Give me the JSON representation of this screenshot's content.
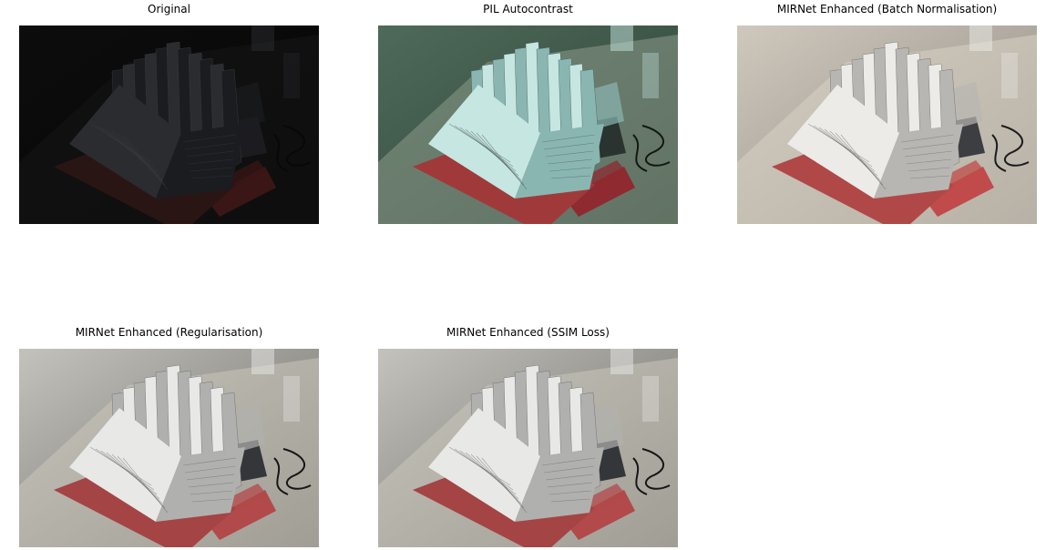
{
  "panels": [
    {
      "title": "Original",
      "variant": "dark"
    },
    {
      "title": "PIL Autocontrast",
      "variant": "teal"
    },
    {
      "title": "MIRNet Enhanced (Batch Normalisation)",
      "variant": "warm"
    },
    {
      "title": "MIRNet Enhanced (Regularisation)",
      "variant": "neutral"
    },
    {
      "title": "MIRNet Enhanced (SSIM Loss)",
      "variant": "neutral"
    }
  ],
  "palettes": {
    "dark": {
      "wall": "#0d0d0d",
      "wall_shade": "#050505",
      "desk": "#151515",
      "paper": "#2a2c30",
      "paper_shade": "#1b1c20",
      "page_lines": "#3a3c40",
      "cover": "#2a1515",
      "stapler": "#3a1616",
      "box": "#1c1c20",
      "cable": "#080808"
    },
    "teal": {
      "wall": "#4e6a5a",
      "wall_shade": "#2e4236",
      "desk": "#8c9a8a",
      "paper": "#c6e6e2",
      "paper_shade": "#8ab6b2",
      "page_lines": "#4a5a58",
      "cover": "#a03a3a",
      "stapler": "#8e2a30",
      "box": "#2a3330",
      "cable": "#111814"
    },
    "warm": {
      "wall": "#cfc8bd",
      "wall_shade": "#8f8a82",
      "desk": "#d9d2c4",
      "paper": "#ecebe8",
      "paper_shade": "#b8b6b2",
      "page_lines": "#6a6864",
      "cover": "#b04848",
      "stapler": "#c04b4a",
      "box": "#3d3e42",
      "cable": "#1b1b1b"
    },
    "neutral": {
      "wall": "#c4c2bc",
      "wall_shade": "#6e6c67",
      "desk": "#cbc6bb",
      "paper": "#e8e8e6",
      "paper_shade": "#b0b0ae",
      "page_lines": "#66656a",
      "cover": "#a44444",
      "stapler": "#b2494a",
      "box": "#35363a",
      "cable": "#161616"
    }
  }
}
